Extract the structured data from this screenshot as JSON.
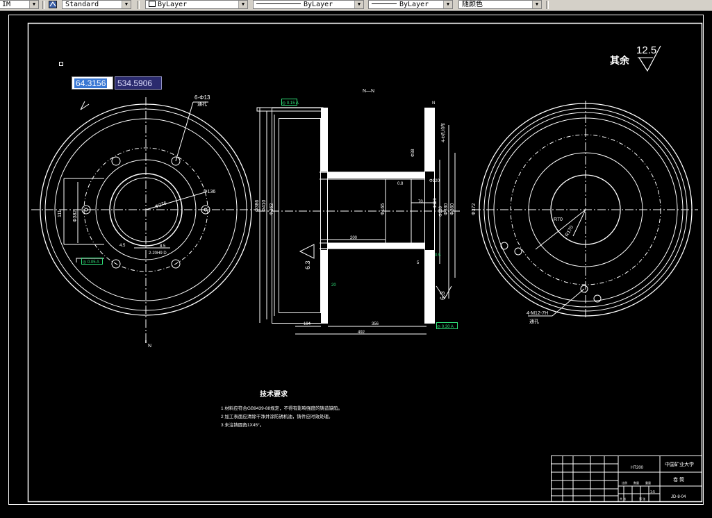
{
  "toolbar": {
    "dimstyle": "IM",
    "textstyle": "Standard",
    "layer": "ByLayer",
    "linetype": "ByLayer",
    "lineweight": "ByLayer",
    "color": "随颜色"
  },
  "dynamic_input": {
    "x": "64.3156",
    "y": "534.5906"
  },
  "roughness": {
    "label": "其余",
    "value": "12.5"
  },
  "section_label": "N—N",
  "section_mark": "N",
  "left_view": {
    "holes_note_a": "6-Φ13",
    "holes_note_b": "通孔",
    "dims": [
      "Φ136",
      "Φ276",
      "111",
      "Φ382",
      "2-20H9 D",
      "4.5",
      "8.5"
    ],
    "tolerance": [
      "◎ 0.05 A"
    ]
  },
  "section_view": {
    "dims": [
      "Φ386",
      "Φ410",
      "Φ362",
      "Φ165",
      "Φ330",
      "Φ360",
      "Φ372",
      "Φ120",
      "Φ136",
      "Φ120",
      "Φ38",
      "4-Φ孔均布",
      "70",
      "200",
      "356",
      "194",
      "492",
      "20",
      "7.5",
      "5",
      "0.5",
      "6.3",
      "6.3",
      "0.8"
    ],
    "tolerance": [
      "◎ 0.15 A",
      "◎ 0.30 A"
    ]
  },
  "right_view": {
    "dims": [
      "R70",
      "R170",
      "4-M12-7H",
      "通孔"
    ]
  },
  "tech_req": {
    "title": "技术要求",
    "lines": [
      "1 材料应符合GB9439-88规定，不得有影响强度的铸造缺陷。",
      "2 加工表面应清除干净并涂防锈机油，铸件应时效处理。",
      "3 未注铸圆角1X45°。"
    ]
  },
  "title_block": {
    "material": "HT200",
    "university": "中国矿业大学",
    "part_name": "卷 筒",
    "scale": "1:5",
    "drawing_no": "JD-8-04",
    "small": [
      "比例",
      "数量",
      "重量",
      "共 张",
      "第 张"
    ]
  }
}
